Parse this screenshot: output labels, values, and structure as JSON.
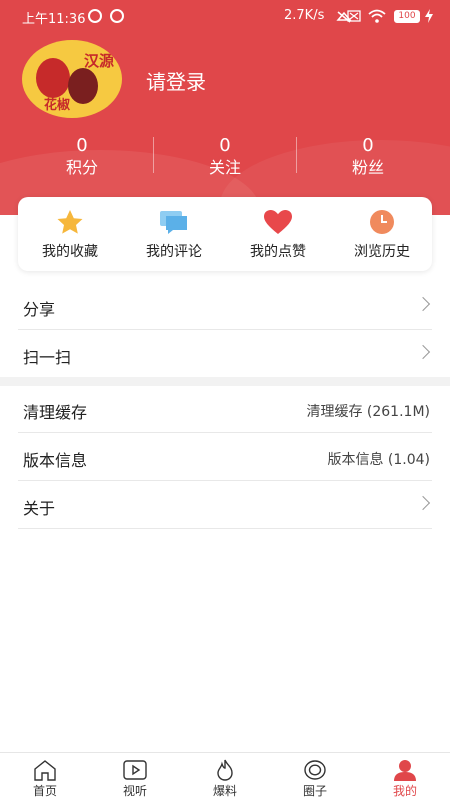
{
  "status_bar": {
    "time": "上午11:36",
    "network_speed": "2.7K/s",
    "battery": "100"
  },
  "profile": {
    "avatar_text_top": "汉源",
    "avatar_text_bottom": "花椒",
    "login_label": "请登录"
  },
  "stats": [
    {
      "value": "0",
      "label": "积分"
    },
    {
      "value": "0",
      "label": "关注"
    },
    {
      "value": "0",
      "label": "粉丝"
    }
  ],
  "quick_actions": [
    {
      "label": "我的收藏",
      "icon": "star-icon",
      "color": "#f6b73c"
    },
    {
      "label": "我的评论",
      "icon": "comment-icon",
      "color": "#5bb0e8"
    },
    {
      "label": "我的点赞",
      "icon": "heart-icon",
      "color": "#e8484b"
    },
    {
      "label": "浏览历史",
      "icon": "clock-icon",
      "color": "#f08a5d"
    }
  ],
  "menu_group_1": [
    {
      "label": "分享"
    },
    {
      "label": "扫一扫"
    }
  ],
  "menu_group_2": [
    {
      "label": "清理缓存",
      "value": "清理缓存 (261.1M)"
    },
    {
      "label": "版本信息",
      "value": "版本信息 (1.04)"
    },
    {
      "label": "关于"
    }
  ],
  "tabs": [
    {
      "label": "首页",
      "icon": "home-icon"
    },
    {
      "label": "视听",
      "icon": "play-icon"
    },
    {
      "label": "爆料",
      "icon": "fire-icon"
    },
    {
      "label": "圈子",
      "icon": "circle-icon"
    },
    {
      "label": "我的",
      "icon": "user-icon",
      "active": true
    }
  ],
  "colors": {
    "accent": "#e0474a"
  }
}
